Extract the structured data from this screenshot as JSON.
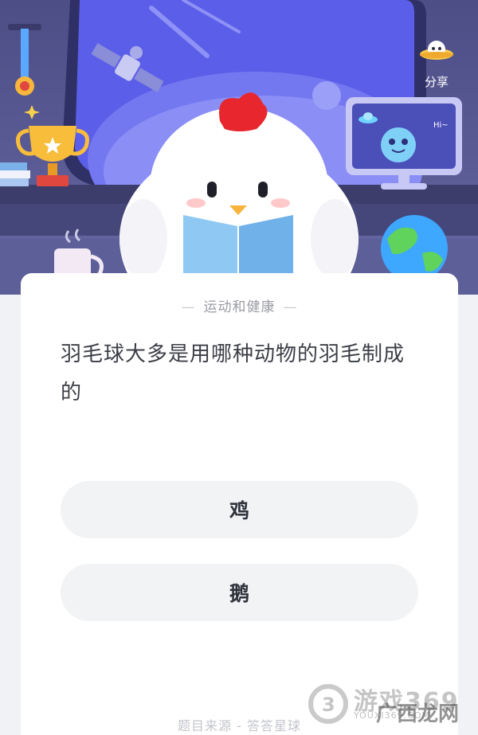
{
  "header": {
    "share_label": "分享"
  },
  "card": {
    "category": "运动和健康",
    "question": "羽毛球大多是用哪种动物的羽毛制成的",
    "options": [
      {
        "label": "鸡"
      },
      {
        "label": "鹅"
      }
    ],
    "source": "题目来源 - 答答星球"
  },
  "watermark": {
    "text": "游戏369",
    "sub": "YOUXI369.COM",
    "overlay": "广西龙网"
  },
  "colors": {
    "scene_bg": "#4d4e86",
    "card_bg": "#ffffff",
    "option_bg": "#f2f3f5",
    "text_primary": "#3b3e46",
    "text_muted": "#9a9ca3"
  }
}
